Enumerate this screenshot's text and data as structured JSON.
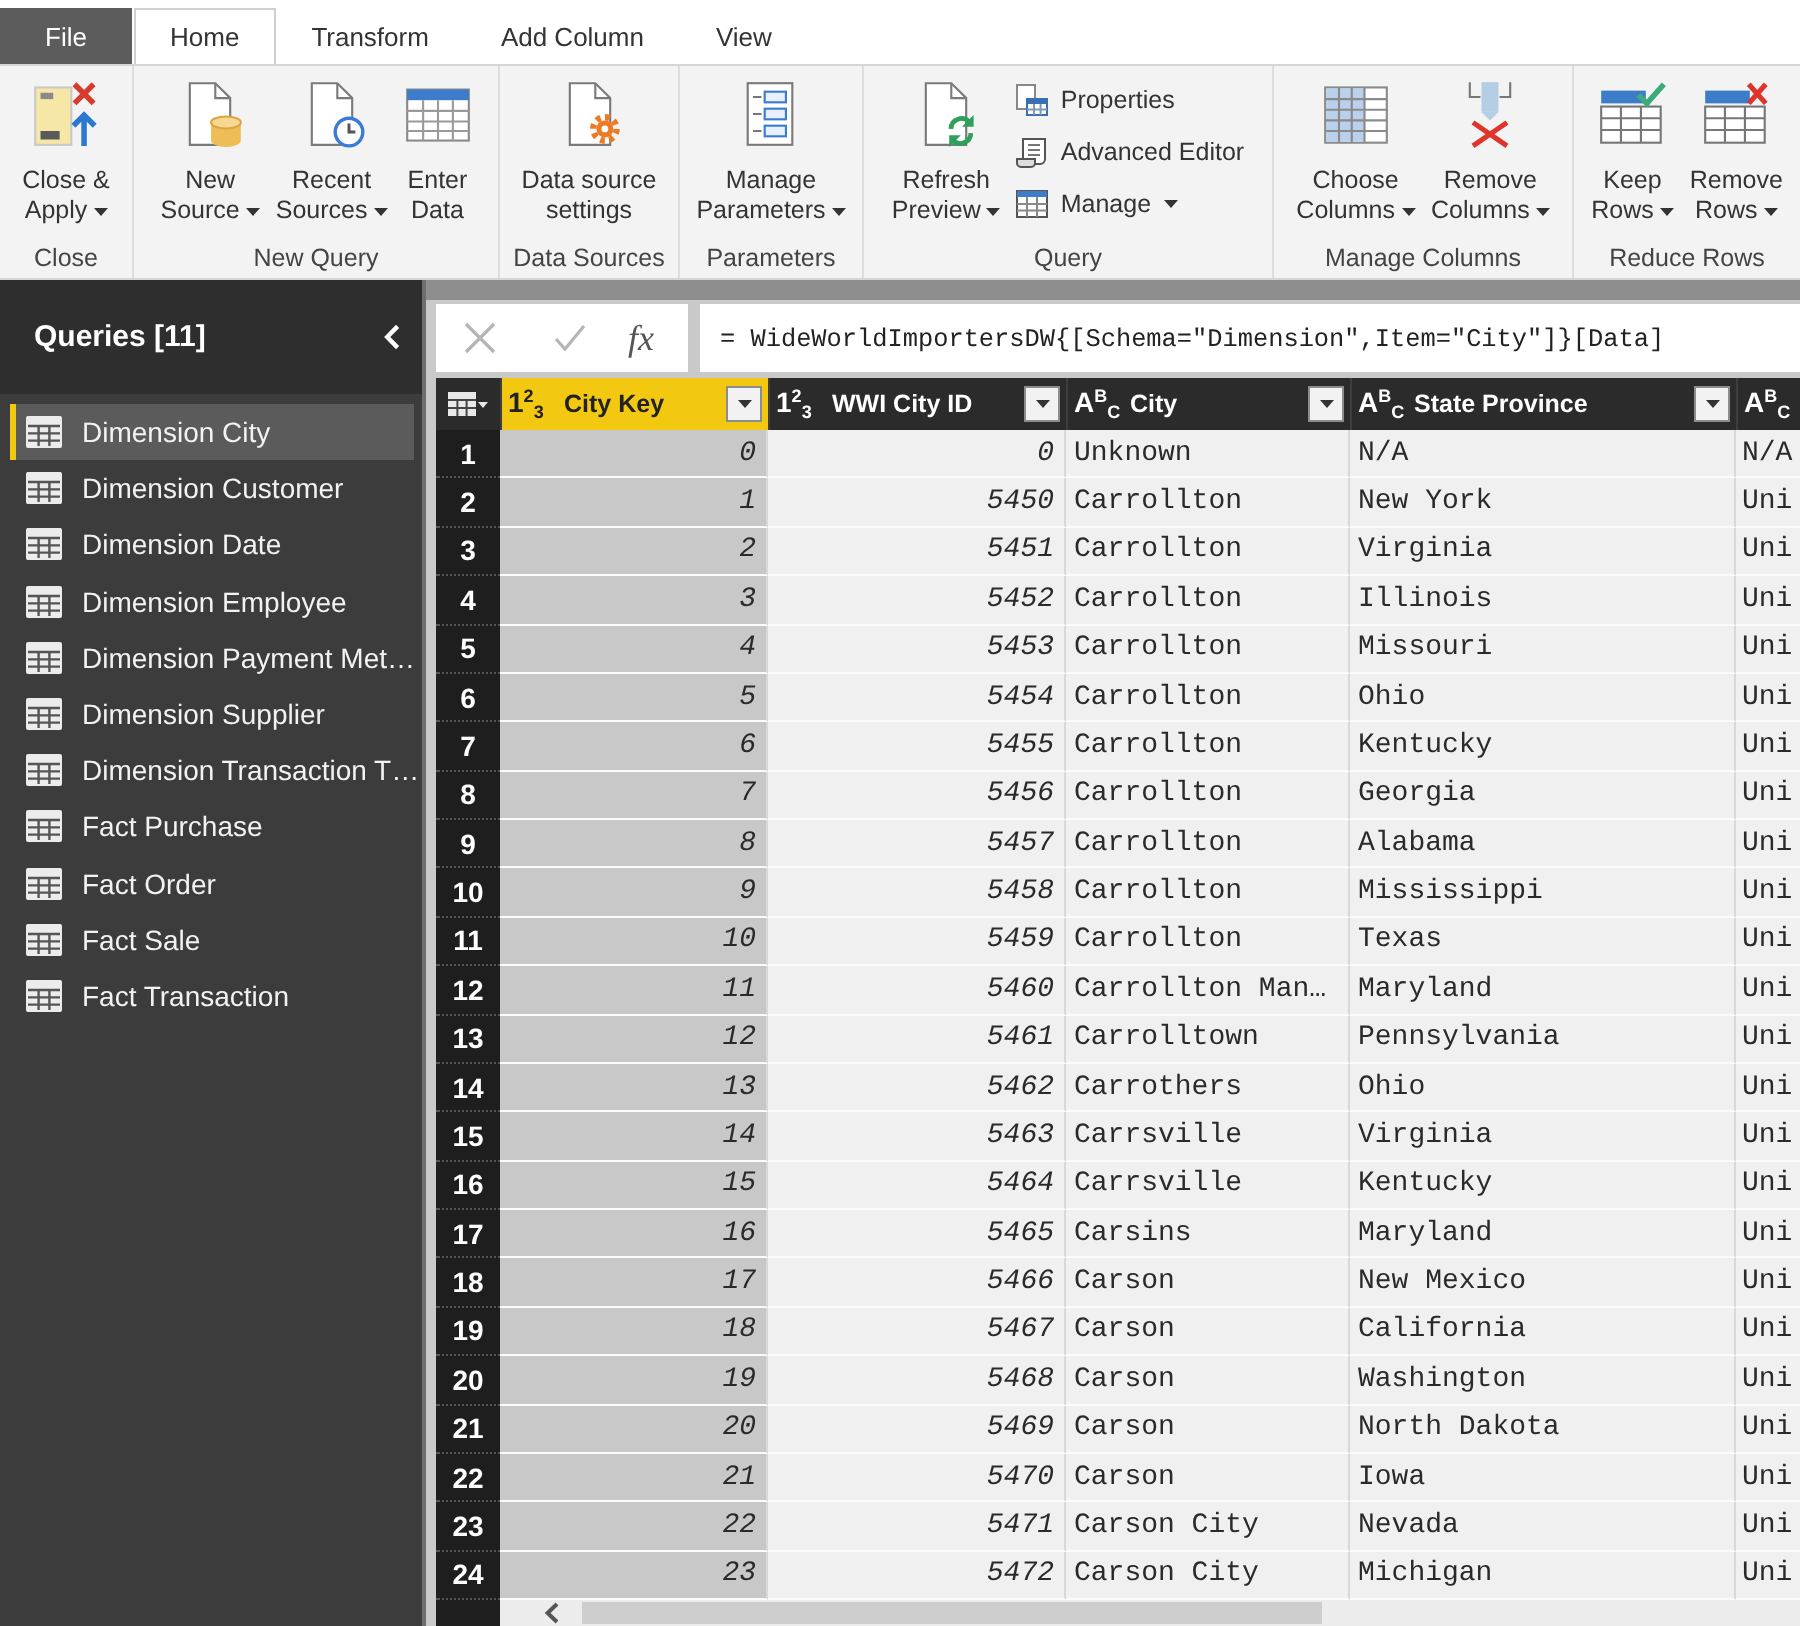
{
  "ribbon_tabs": [
    {
      "label": "File",
      "kind": "file",
      "selected": false
    },
    {
      "label": "Home",
      "kind": "tab",
      "selected": true
    },
    {
      "label": "Transform",
      "kind": "tab",
      "selected": false
    },
    {
      "label": "Add Column",
      "kind": "tab",
      "selected": false
    },
    {
      "label": "View",
      "kind": "tab",
      "selected": false
    }
  ],
  "ribbon": {
    "groups": [
      {
        "label": "Close",
        "buttons": [
          {
            "kind": "large",
            "lines": [
              "Close &",
              "Apply"
            ],
            "dropdown": true
          }
        ]
      },
      {
        "label": "New Query",
        "buttons": [
          {
            "kind": "large",
            "lines": [
              "New",
              "Source"
            ],
            "dropdown": true
          },
          {
            "kind": "large",
            "lines": [
              "Recent",
              "Sources"
            ],
            "dropdown": true
          },
          {
            "kind": "large",
            "lines": [
              "Enter",
              "Data"
            ],
            "dropdown": false
          }
        ]
      },
      {
        "label": "Data Sources",
        "buttons": [
          {
            "kind": "large",
            "lines": [
              "Data source",
              "settings"
            ],
            "dropdown": false
          }
        ]
      },
      {
        "label": "Parameters",
        "buttons": [
          {
            "kind": "large",
            "lines": [
              "Manage",
              "Parameters"
            ],
            "dropdown": true
          }
        ]
      },
      {
        "label": "Query",
        "buttons": [
          {
            "kind": "large",
            "lines": [
              "Refresh",
              "Preview"
            ],
            "dropdown": true
          },
          {
            "kind": "small",
            "lines": [
              "Properties"
            ],
            "dropdown": false
          },
          {
            "kind": "small",
            "lines": [
              "Advanced Editor"
            ],
            "dropdown": false
          },
          {
            "kind": "small",
            "lines": [
              "Manage"
            ],
            "dropdown": true
          }
        ]
      },
      {
        "label": "Manage Columns",
        "buttons": [
          {
            "kind": "large",
            "lines": [
              "Choose",
              "Columns"
            ],
            "dropdown": true
          },
          {
            "kind": "large",
            "lines": [
              "Remove",
              "Columns"
            ],
            "dropdown": true
          }
        ]
      },
      {
        "label": "Reduce Rows",
        "buttons": [
          {
            "kind": "large",
            "lines": [
              "Keep",
              "Rows"
            ],
            "dropdown": true
          },
          {
            "kind": "large",
            "lines": [
              "Remove",
              "Rows"
            ],
            "dropdown": true
          }
        ]
      }
    ]
  },
  "queries_pane": {
    "title": "Queries [11]",
    "items": [
      {
        "label": "Dimension City",
        "selected": true
      },
      {
        "label": "Dimension Customer",
        "selected": false
      },
      {
        "label": "Dimension Date",
        "selected": false
      },
      {
        "label": "Dimension Employee",
        "selected": false
      },
      {
        "label": "Dimension Payment Met…",
        "selected": false
      },
      {
        "label": "Dimension Supplier",
        "selected": false
      },
      {
        "label": "Dimension Transaction T…",
        "selected": false
      },
      {
        "label": "Fact Purchase",
        "selected": false
      },
      {
        "label": "Fact Order",
        "selected": false
      },
      {
        "label": "Fact Sale",
        "selected": false
      },
      {
        "label": "Fact Transaction",
        "selected": false
      }
    ]
  },
  "formula_bar": {
    "function_label": "fx",
    "formula": "= WideWorldImportersDW{[Schema=\"Dimension\",Item=\"City\"]}[Data]"
  },
  "table": {
    "columns": [
      {
        "kind": "number",
        "type_symbol": "1$^{2}$$_{3}$",
        "label": "City Key",
        "selected": true
      },
      {
        "kind": "number",
        "type_symbol": "1$^{2}$$_{3}$",
        "label": "WWI City ID",
        "selected": false
      },
      {
        "kind": "text",
        "type_symbol": "A$^{B}$$_{C}$",
        "label": "City",
        "selected": false
      },
      {
        "kind": "text",
        "type_symbol": "A$^{B}$$_{C}$",
        "label": "State Province",
        "selected": false
      },
      {
        "kind": "text",
        "type_symbol": "A$^{B}$$_{C}$",
        "selected": false
      }
    ],
    "rows": [
      {
        "number": "1",
        "cells": [
          "0",
          "0",
          "Unknown",
          "N/A",
          "N/A"
        ]
      },
      {
        "number": "2",
        "cells": [
          "1",
          "5450",
          "Carrollton",
          "New York",
          "Uni"
        ]
      },
      {
        "number": "3",
        "cells": [
          "2",
          "5451",
          "Carrollton",
          "Virginia",
          "Uni"
        ]
      },
      {
        "number": "4",
        "cells": [
          "3",
          "5452",
          "Carrollton",
          "Illinois",
          "Uni"
        ]
      },
      {
        "number": "5",
        "cells": [
          "4",
          "5453",
          "Carrollton",
          "Missouri",
          "Uni"
        ]
      },
      {
        "number": "6",
        "cells": [
          "5",
          "5454",
          "Carrollton",
          "Ohio",
          "Uni"
        ]
      },
      {
        "number": "7",
        "cells": [
          "6",
          "5455",
          "Carrollton",
          "Kentucky",
          "Uni"
        ]
      },
      {
        "number": "8",
        "cells": [
          "7",
          "5456",
          "Carrollton",
          "Georgia",
          "Uni"
        ]
      },
      {
        "number": "9",
        "cells": [
          "8",
          "5457",
          "Carrollton",
          "Alabama",
          "Uni"
        ]
      },
      {
        "number": "10",
        "cells": [
          "9",
          "5458",
          "Carrollton",
          "Mississippi",
          "Uni"
        ]
      },
      {
        "number": "11",
        "cells": [
          "10",
          "5459",
          "Carrollton",
          "Texas",
          "Uni"
        ]
      },
      {
        "number": "12",
        "cells": [
          "11",
          "5460",
          "Carrollton Man…",
          "Maryland",
          "Uni"
        ]
      },
      {
        "number": "13",
        "cells": [
          "12",
          "5461",
          "Carrolltown",
          "Pennsylvania",
          "Uni"
        ]
      },
      {
        "number": "14",
        "cells": [
          "13",
          "5462",
          "Carrothers",
          "Ohio",
          "Uni"
        ]
      },
      {
        "number": "15",
        "cells": [
          "14",
          "5463",
          "Carrsville",
          "Virginia",
          "Uni"
        ]
      },
      {
        "number": "16",
        "cells": [
          "15",
          "5464",
          "Carrsville",
          "Kentucky",
          "Uni"
        ]
      },
      {
        "number": "17",
        "cells": [
          "16",
          "5465",
          "Carsins",
          "Maryland",
          "Uni"
        ]
      },
      {
        "number": "18",
        "cells": [
          "17",
          "5466",
          "Carson",
          "New Mexico",
          "Uni"
        ]
      },
      {
        "number": "19",
        "cells": [
          "18",
          "5467",
          "Carson",
          "California",
          "Uni"
        ]
      },
      {
        "number": "20",
        "cells": [
          "19",
          "5468",
          "Carson",
          "Washington",
          "Uni"
        ]
      },
      {
        "number": "21",
        "cells": [
          "20",
          "5469",
          "Carson",
          "North Dakota",
          "Uni"
        ]
      },
      {
        "number": "22",
        "cells": [
          "21",
          "5470",
          "Carson",
          "Iowa",
          "Uni"
        ]
      },
      {
        "number": "23",
        "cells": [
          "22",
          "5471",
          "Carson City",
          "Nevada",
          "Uni"
        ]
      },
      {
        "number": "24",
        "cells": [
          "23",
          "5472",
          "Carson City",
          "Michigan",
          "Uni"
        ]
      }
    ]
  }
}
